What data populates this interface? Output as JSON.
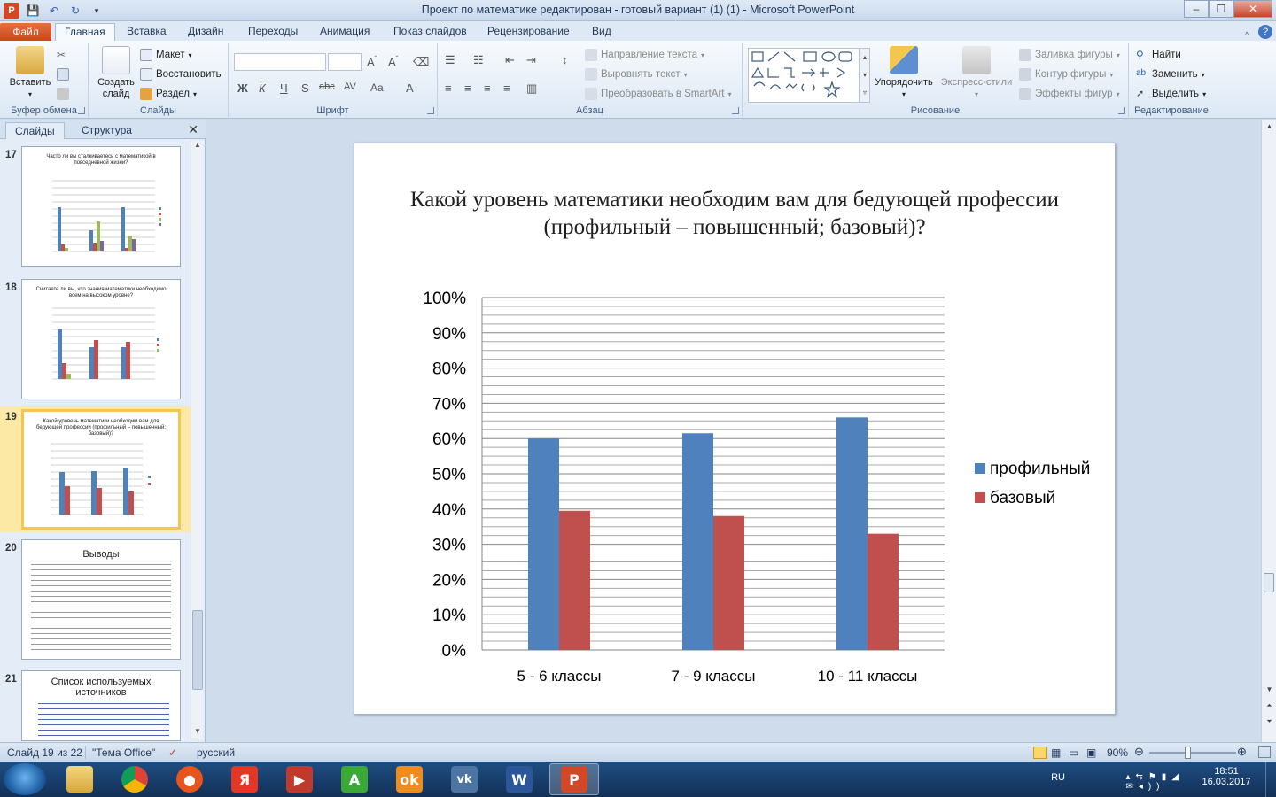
{
  "window": {
    "title": "Проект по математике редактирован - готовый вариант (1) (1)  -  Microsoft PowerPoint",
    "app_icon_letter": "P"
  },
  "tabs": [
    {
      "label": "Файл"
    },
    {
      "label": "Главная"
    },
    {
      "label": "Вставка"
    },
    {
      "label": "Дизайн"
    },
    {
      "label": "Переходы"
    },
    {
      "label": "Анимация"
    },
    {
      "label": "Показ слайдов"
    },
    {
      "label": "Рецензирование"
    },
    {
      "label": "Вид"
    }
  ],
  "ribbon": {
    "clipboard": {
      "label": "Буфер обмена",
      "paste": "Вставить"
    },
    "slides": {
      "label": "Слайды",
      "new_slide": "Создать слайд",
      "layout": "Макет",
      "reset": "Восстановить",
      "section": "Раздел"
    },
    "font": {
      "label": "Шрифт"
    },
    "paragraph": {
      "label": "Абзац",
      "text_direction": "Направление текста",
      "align_text": "Выровнять текст",
      "smartart": "Преобразовать в SmartArt"
    },
    "drawing": {
      "label": "Рисование",
      "arrange": "Упорядочить",
      "quick_styles": "Экспресс-стили",
      "fill": "Заливка фигуры",
      "outline": "Контур фигуры",
      "effects": "Эффекты фигур"
    },
    "editing": {
      "label": "Редактирование",
      "find": "Найти",
      "replace": "Заменить",
      "select": "Выделить"
    }
  },
  "panel": {
    "tab_slides": "Слайды",
    "tab_outline": "Структура",
    "thumbs": [
      {
        "num": "17",
        "title": "Часто ли вы сталкиваетесь с математикой в повседневной жизни?"
      },
      {
        "num": "18",
        "title": "Считаете ли вы, что знания математики необходимо всем на высоком уровне?"
      },
      {
        "num": "19",
        "title": "Какой уровень математики необходим вам для бедующей профессии (профильный – повышенный; базовый)?"
      },
      {
        "num": "20",
        "title": "Выводы"
      },
      {
        "num": "21",
        "title": "Список используемых источников"
      }
    ]
  },
  "slide": {
    "title": "Какой уровень  математики необходим  вам для бедующей профессии (профильный – повышенный;  базовый)?"
  },
  "chart_data": {
    "type": "bar",
    "categories": [
      "5 - 6 классы",
      "7 - 9 классы",
      "10 - 11 классы"
    ],
    "series": [
      {
        "name": "профильный",
        "values": [
          60,
          61.5,
          66
        ],
        "color": "#4f81bd"
      },
      {
        "name": "базовый",
        "values": [
          39.5,
          38,
          33
        ],
        "color": "#c0504d"
      }
    ],
    "ylim": [
      0,
      100
    ],
    "yticks": [
      "0%",
      "10%",
      "20%",
      "30%",
      "40%",
      "50%",
      "60%",
      "70%",
      "80%",
      "90%",
      "100%"
    ],
    "grid": true,
    "legend": "right"
  },
  "status": {
    "slide_pos": "Слайд 19 из 22",
    "theme": "\"Тема Office\"",
    "language": "русский",
    "zoom": "90%"
  },
  "taskbar": {
    "lang": "RU",
    "time": "18:51",
    "date": "16.03.2017"
  }
}
